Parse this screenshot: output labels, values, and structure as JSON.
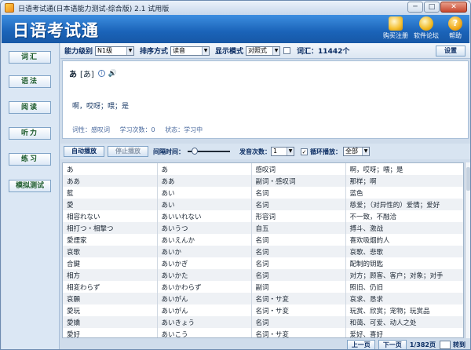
{
  "window": {
    "title": "日语考试通(日本语能力测试-综合版) 2.1 试用版",
    "buttons": [
      "─",
      "□",
      "✕"
    ]
  },
  "header": {
    "brand": "日语考试通",
    "buttons": [
      {
        "label": "购买注册",
        "icon": "buy-register-icon"
      },
      {
        "label": "软件论坛",
        "icon": "forum-lightbulb-icon"
      },
      {
        "label": "帮助",
        "icon": "help-question-icon"
      }
    ]
  },
  "sidebar": {
    "items": [
      "词汇",
      "语法",
      "阅读",
      "听力",
      "练习",
      "模拟测试"
    ]
  },
  "toolbar": {
    "level_label": "能力级别",
    "level_value": "N1级",
    "sort_label": "排序方式",
    "sort_value": "读音",
    "display_label": "显示模式",
    "display_value": "对照式",
    "vocab_count": "词汇：11442个",
    "settings_label": "设置"
  },
  "detail": {
    "word": "あ",
    "reading": "[あ]",
    "meaning": "啊，哎呀；喂；是",
    "pos": "词性：感叹词",
    "study_count": "学习次数：0",
    "status": "状态：学习中"
  },
  "playbar": {
    "auto_play": "自动播放",
    "stop_play": "停止播放",
    "interval_label": "间隔时间：",
    "interval_position": 0.1,
    "repeat_label": "发音次数：",
    "repeat_value": "1",
    "loop_label": "循环播放：",
    "loop_checked": true,
    "loop_value": "全部"
  },
  "table": {
    "rows": [
      [
        "あ",
        "あ",
        "感叹词",
        "啊，哎呀；喂；是"
      ],
      [
        "ああ",
        "ああ",
        "副词・感叹词",
        "那样；啊"
      ],
      [
        "藍",
        "あい",
        "名词",
        "蓝色"
      ],
      [
        "愛",
        "あい",
        "名词",
        "慈爱；（对异性的）爱情；爱好"
      ],
      [
        "相容れない",
        "あいいれない",
        "形容词",
        "不一致，不融洽"
      ],
      [
        "相打つ・相撃つ",
        "あいうつ",
        "自五",
        "搏斗、激战"
      ],
      [
        "愛煙家",
        "あいえんか",
        "名词",
        "喜欢吸烟的人"
      ],
      [
        "哀歌",
        "あいか",
        "名词",
        "哀歌、悲歌"
      ],
      [
        "合鍵",
        "あいかぎ",
        "名词",
        "配制的钥匙"
      ],
      [
        "相方",
        "あいかた",
        "名词",
        "对方；顾客、客户；对象；对手"
      ],
      [
        "相変わらず",
        "あいかわらず",
        "副词",
        "照旧、仍旧"
      ],
      [
        "哀願",
        "あいがん",
        "名词・サ変",
        "哀求、恳求"
      ],
      [
        "愛玩",
        "あいがん",
        "名词・サ変",
        "玩赏、欣赏；宠物；玩赏品"
      ],
      [
        "愛嬌",
        "あいきょう",
        "名词",
        "和蔼、可爱、动人之处"
      ],
      [
        "愛好",
        "あいこう",
        "名词・サ変",
        "爱好、喜好"
      ]
    ]
  },
  "pager": {
    "prev": "上一页",
    "next": "下一页",
    "info": "1/382页",
    "go": "转到"
  }
}
